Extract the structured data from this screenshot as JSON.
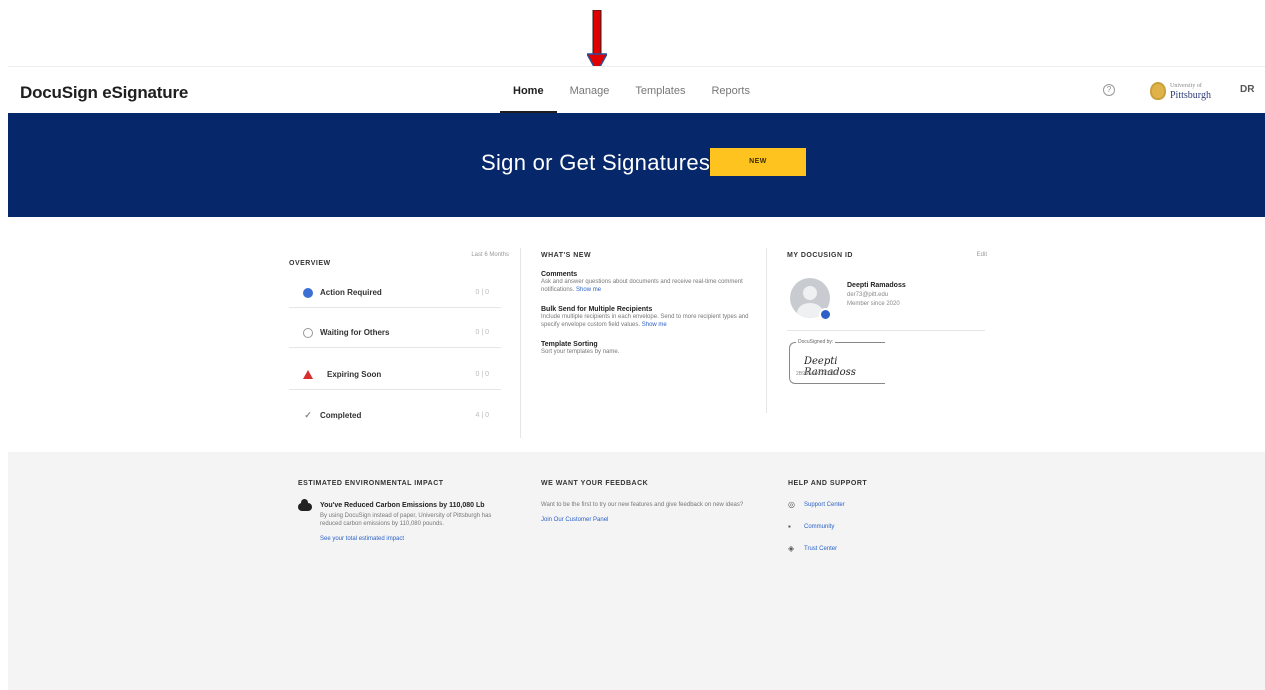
{
  "annotation": {
    "arrow_color": "#e00000"
  },
  "header": {
    "brand": "DocuSign eSignature",
    "tabs": [
      {
        "label": "Home",
        "active": true
      },
      {
        "label": "Manage",
        "active": false
      },
      {
        "label": "Templates",
        "active": false
      },
      {
        "label": "Reports",
        "active": false
      }
    ],
    "help_icon": "question-circle-icon",
    "account_logo": {
      "top": "University of",
      "main": "Pittsburgh"
    },
    "user_initials": "DR"
  },
  "banner": {
    "title": "Sign or Get Signatures",
    "start_button": "NEW",
    "background": "#07276b",
    "button_color": "#ffc31f"
  },
  "overview": {
    "heading": "OVERVIEW",
    "range": "Last 6 Months",
    "rows": [
      {
        "label": "Action Required",
        "count": "0 | 0",
        "icon": "action-dot-icon"
      },
      {
        "label": "Waiting for Others",
        "count": "0 | 0",
        "icon": "clock-icon"
      },
      {
        "label": "Expiring Soon",
        "count": "0 | 0",
        "icon": "warning-icon"
      },
      {
        "label": "Completed",
        "count": "4 | 0",
        "icon": "check-icon"
      }
    ]
  },
  "whats_new": {
    "heading": "WHAT'S NEW",
    "items": [
      {
        "title": "Comments",
        "body": "Ask and answer questions about documents and receive real-time comment notifications.",
        "link": "Show me"
      },
      {
        "title": "Bulk Send for Multiple Recipients",
        "body": "Include multiple recipients in each envelope. Send to more recipient types and specify envelope custom field values.",
        "link": "Show me"
      },
      {
        "title": "Template Sorting",
        "body": "Sort your templates by name.",
        "link": ""
      }
    ]
  },
  "my_docusign": {
    "heading": "MY DOCUSIGN ID",
    "edit": "Edit",
    "name": "Deepti Ramadoss",
    "email": "der73@pitt.edu",
    "member_since": "Member since 2020",
    "signature_caption": "DocuSigned by:",
    "signature": "Deepti Ramadoss",
    "signature_id": "2B9A9A8C3F75E4..."
  },
  "environment": {
    "heading": "ESTIMATED ENVIRONMENTAL IMPACT",
    "title": "You've Reduced Carbon Emissions by 110,080 Lb",
    "body": "By using DocuSign instead of paper, University of Pittsburgh has reduced carbon emissions by 110,080 pounds.",
    "link": "See your total estimated impact"
  },
  "feedback": {
    "heading": "WE WANT YOUR FEEDBACK",
    "body": "Want to be the first to try our new features and give feedback on new ideas?",
    "link": "Join Our Customer Panel"
  },
  "help_support": {
    "heading": "HELP AND SUPPORT",
    "items": [
      {
        "label": "Support Center",
        "icon": "support-icon"
      },
      {
        "label": "Community",
        "icon": "community-icon"
      },
      {
        "label": "Trust Center",
        "icon": "shield-icon"
      }
    ]
  }
}
